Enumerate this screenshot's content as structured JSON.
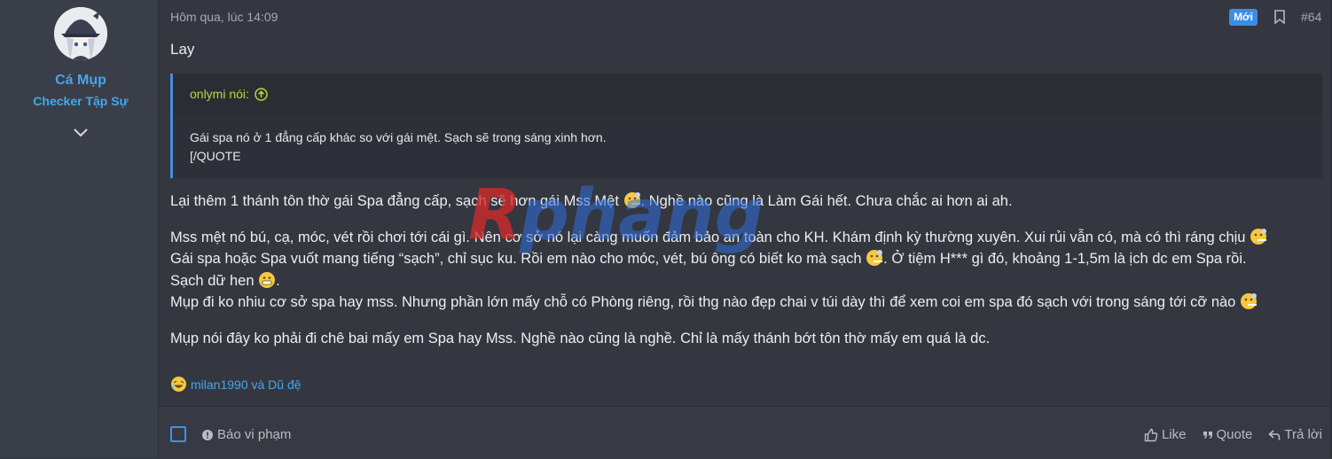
{
  "user": {
    "name": "Cá Mụp",
    "title": "Checker Tập Sự",
    "avatar_icon": "avatar-girl-witch-hat",
    "expand_icon": "chevron-down-icon"
  },
  "post": {
    "date": "Hôm qua, lúc 14:09",
    "new_label": "Mới",
    "number": "#64",
    "first_line": "Lay",
    "quote": {
      "author_label": "onlymi nói:",
      "line1": "Gái spa nó ở 1 đẳng cấp khác so với gái mệt. Sạch sẽ trong sáng xinh hơn.",
      "line2": "[/QUOTE"
    },
    "paragraphs": {
      "p1a": "Lại thêm 1 thánh tôn thờ gái Spa đẳng cấp, sạch sẽ hơn gái Mss Mệt ",
      "p1b": ". Nghề nào cũng là Làm Gái hết. Chưa chắc ai hơn ai ah.",
      "p2": "Mss mệt nó bú, cạ, móc, vét rồi chơi tới cái gì. Nên cơ sở nó lại càng muốn đảm bảo an toàn cho KH. Khám định kỳ thường xuyên. Xui rủi vẫn có, mà có thì ráng chịu ",
      "p3a": "Gái spa hoặc Spa vuốt mang tiếng “sạch”, chỉ sục ku. Rồi em nào cho móc, vét, bú ông có biết ko mà sạch ",
      "p3b": ". Ở tiệm H*** gì đó, khoảng 1-1,5m là ịch dc em Spa rồi.",
      "p4": "Sạch dữ hen ",
      "p4b": ".",
      "p5": "Mụp đi ko nhiu cơ sở spa hay mss. Nhưng phần lớn mấy chỗ có Phòng riêng, rồi thg nào đẹp chai v túi dày thì để xem coi em spa đó sạch với trong sáng tới cỡ nào ",
      "p6": "Mụp nói đây ko phải đi chê bai mấy em Spa hay Mss. Nghề nào cũng là nghề. Chỉ là mấy thánh bớt tôn thờ mấy em quá là dc."
    },
    "watermark": "Rphang",
    "reactions": "milan1990 và Dũ đệ"
  },
  "footer": {
    "report": "Báo vi phạm",
    "like": "Like",
    "quote": "Quote",
    "reply": "Trả lời"
  },
  "colors": {
    "accent": "#3a8ee6",
    "username": "#46a6ec",
    "quote_author": "#b4dc3c",
    "watermark_red": "#d42a2a",
    "watermark_blue": "#2f6fe0"
  }
}
